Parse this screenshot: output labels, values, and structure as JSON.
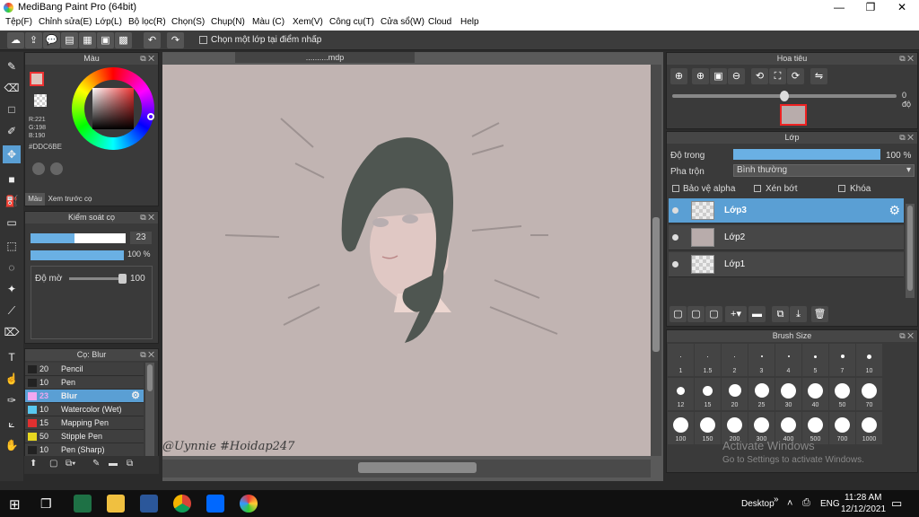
{
  "window": {
    "title": "MediBang Paint Pro (64bit)",
    "min": "—",
    "max": "❐",
    "close": "✕"
  },
  "menu": [
    "Tệp(F)",
    "Chỉnh sửa(E)",
    "Lớp(L)",
    "Bộ lọc(R)",
    "Chọn(S)",
    "Chụp(N)",
    "Màu (C)",
    "Xem(V)",
    "Công cụ(T)",
    "Cửa sổ(W)",
    "Cloud",
    "Help"
  ],
  "toolbar": {
    "checkbox_label": "Chọn một lớp tại điểm nhấp"
  },
  "color_panel": {
    "title": "Màu",
    "r": "R:221",
    "g": "G:198",
    "b": "B:190",
    "hex": "#DDC6BE",
    "tab1": "Màu",
    "tab2": "Xem trước cọ",
    "main_color": "#ddc6be"
  },
  "brush_control": {
    "title": "Kiểm soát cọ",
    "size": "23",
    "opacity_pct": "100 %",
    "blur_label": "Độ mờ",
    "blur_value": "100"
  },
  "brush_list": {
    "title": "Cọ: Blur",
    "items": [
      {
        "size": "20",
        "name": "Pencil",
        "color": "#222222"
      },
      {
        "size": "10",
        "name": "Pen",
        "color": "#222222"
      },
      {
        "size": "23",
        "name": "Blur",
        "color": "#f0a8f0"
      },
      {
        "size": "10",
        "name": "Watercolor (Wet)",
        "color": "#58c8f0"
      },
      {
        "size": "15",
        "name": "Mapping Pen",
        "color": "#e03030"
      },
      {
        "size": "50",
        "name": "Stipple Pen",
        "color": "#e8d820"
      },
      {
        "size": "10",
        "name": "Pen (Sharp)",
        "color": "#222222"
      }
    ]
  },
  "document": {
    "tab": "..........mdp",
    "signature": "@Uynnie #Hoidap247"
  },
  "navigator": {
    "title": "Hoa tiêu",
    "angle": "0 độ"
  },
  "layers": {
    "title": "Lớp",
    "opacity_label": "Độ trong",
    "opacity_value": "100 %",
    "blend_label": "Pha trộn",
    "blend_value": "Bình thường",
    "protect_alpha": "Bảo vệ alpha",
    "clip": "Xén bớt",
    "lock": "Khóa",
    "items": [
      "Lớp3",
      "Lớp2",
      "Lớp1"
    ]
  },
  "brush_size": {
    "title": "Brush Size",
    "sizes": [
      "1",
      "1.5",
      "2",
      "3",
      "4",
      "5",
      "7",
      "10",
      "12",
      "15",
      "20",
      "25",
      "30",
      "40",
      "50",
      "70",
      "100",
      "150",
      "200",
      "300",
      "400",
      "500",
      "700",
      "1000"
    ]
  },
  "watermark": {
    "line1": "Activate Windows",
    "line2": "Go to Settings to activate Windows."
  },
  "taskbar": {
    "desktop": "Desktop",
    "lang": "ENG",
    "time": "11:28 AM",
    "date": "12/12/2021"
  }
}
